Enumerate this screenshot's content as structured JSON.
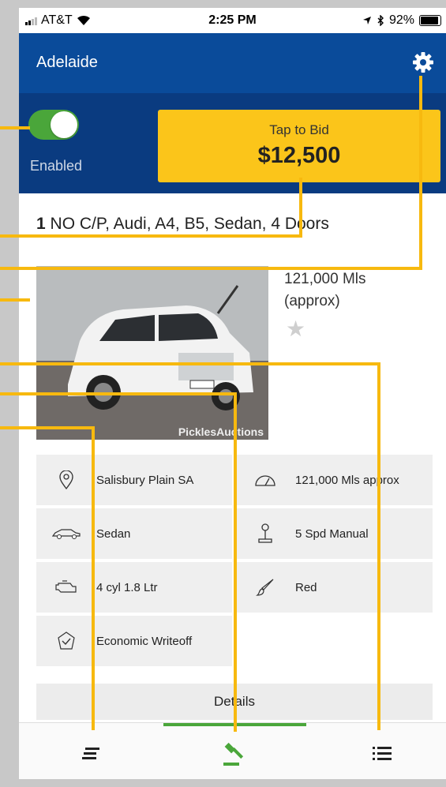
{
  "status_bar": {
    "carrier": "AT&T",
    "time": "2:25 PM",
    "battery": "92%",
    "battery_level": 0.92
  },
  "header": {
    "title": "Adelaide"
  },
  "bid_panel": {
    "toggle_label": "Enabled",
    "toggle_on": true,
    "bid_caption": "Tap to Bid",
    "bid_amount": "$12,500"
  },
  "lot": {
    "number": "1",
    "title": "NO C/P, Audi, A4, B5, Sedan, 4 Doors",
    "mileage_line1": "121,000 Mls",
    "mileage_line2": "(approx)",
    "watermark": "PicklesAuctions"
  },
  "specs": [
    {
      "icon": "location-pin-icon",
      "text": "Salisbury Plain SA"
    },
    {
      "icon": "odometer-icon",
      "text": "121,000 Mls approx"
    },
    {
      "icon": "car-icon",
      "text": "Sedan"
    },
    {
      "icon": "gear-shift-icon",
      "text": "5 Spd Manual"
    },
    {
      "icon": "engine-icon",
      "text": "4 cyl 1.8 Ltr"
    },
    {
      "icon": "paint-brush-icon",
      "text": "Red"
    },
    {
      "icon": "shield-check-icon",
      "text": "Economic Writeoff"
    }
  ],
  "details_label": "Details",
  "colors": {
    "header": "#0a4b9a",
    "bid_bar": "#0a3b80",
    "bid_button": "#fbc51a",
    "accent_green": "#4aa63a",
    "callout": "#f7b90f"
  }
}
